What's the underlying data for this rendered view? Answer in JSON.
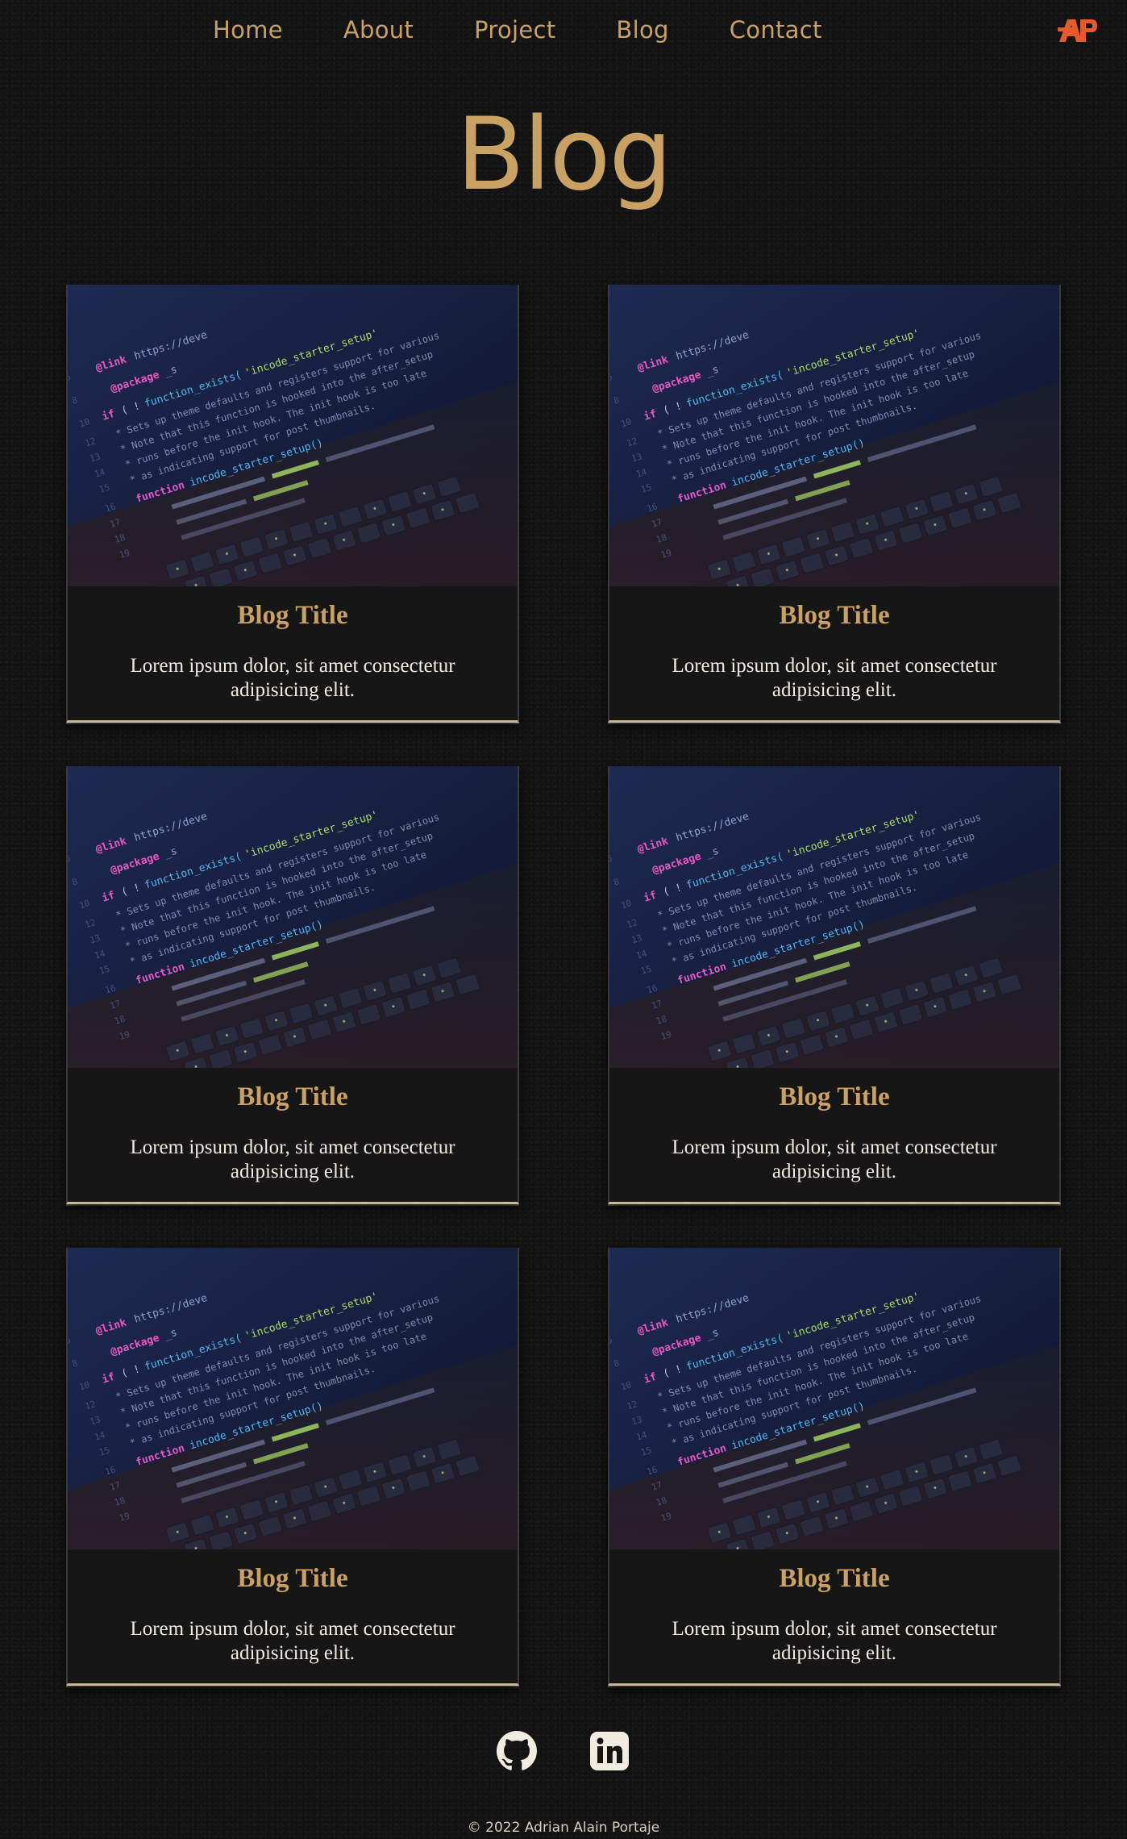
{
  "nav": {
    "items": [
      {
        "label": "Home"
      },
      {
        "label": "About"
      },
      {
        "label": "Project"
      },
      {
        "label": "Blog"
      },
      {
        "label": "Contact"
      }
    ],
    "logo_text": "AP",
    "logo_color": "#e55a2b"
  },
  "page": {
    "title": "Blog"
  },
  "posts": [
    {
      "title": "Blog Title",
      "excerpt": "Lorem ipsum dolor, sit amet consectetur adipisicing elit.",
      "image": "code-on-laptop-screen"
    },
    {
      "title": "Blog Title",
      "excerpt": "Lorem ipsum dolor, sit amet consectetur adipisicing elit.",
      "image": "code-on-laptop-screen"
    },
    {
      "title": "Blog Title",
      "excerpt": "Lorem ipsum dolor, sit amet consectetur adipisicing elit.",
      "image": "code-on-laptop-screen"
    },
    {
      "title": "Blog Title",
      "excerpt": "Lorem ipsum dolor, sit amet consectetur adipisicing elit.",
      "image": "code-on-laptop-screen"
    },
    {
      "title": "Blog Title",
      "excerpt": "Lorem ipsum dolor, sit amet consectetur adipisicing elit.",
      "image": "code-on-laptop-screen"
    },
    {
      "title": "Blog Title",
      "excerpt": "Lorem ipsum dolor, sit amet consectetur adipisicing elit.",
      "image": "code-on-laptop-screen"
    }
  ],
  "footer": {
    "social": [
      {
        "icon": "github-icon"
      },
      {
        "icon": "linkedin-icon"
      }
    ],
    "copyright": "© 2022 Adrian Alain Portaje"
  },
  "colors": {
    "accent": "#c9a163",
    "background": "#141414",
    "text": "#f2ece0"
  }
}
